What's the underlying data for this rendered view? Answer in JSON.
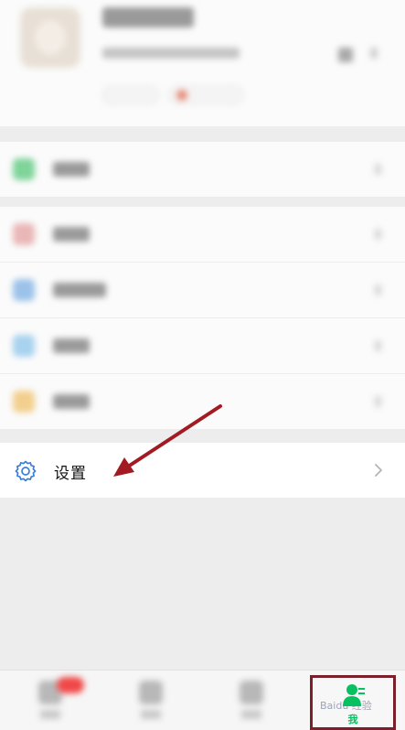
{
  "settings": {
    "label": "设置",
    "icon": "gear-icon"
  },
  "tabbar": {
    "me_label": "我",
    "me_icon": "person-icon",
    "active_color": "#07c160"
  },
  "watermark": {
    "text": "Baidu 经验"
  },
  "annotation": {
    "arrow_color": "#a31b22",
    "box_color": "#7b1f2a"
  }
}
